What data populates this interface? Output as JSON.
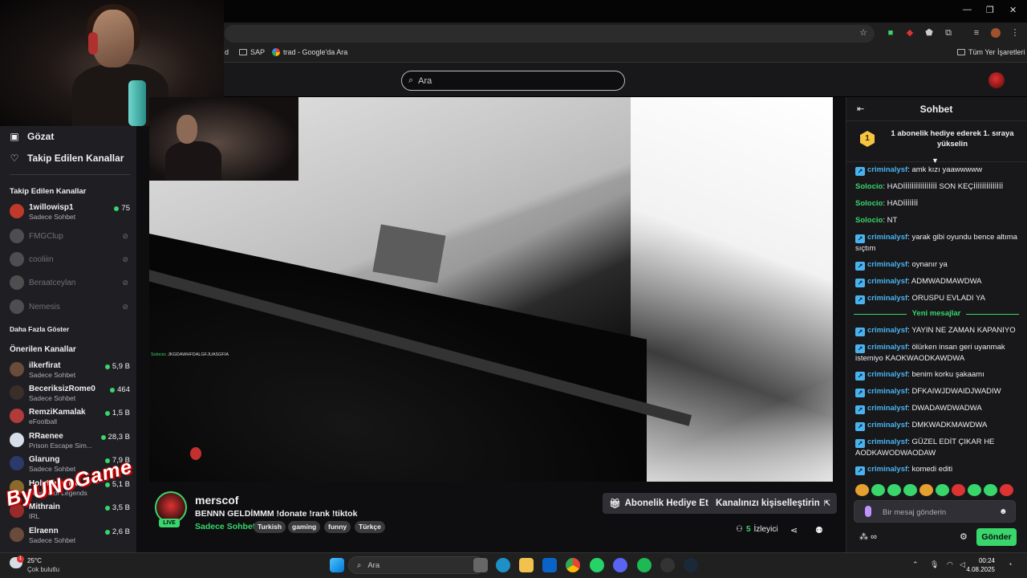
{
  "browser": {
    "bookmarks": [
      {
        "label": "d"
      },
      {
        "label": "SAP"
      },
      {
        "label": "trad - Google'da Ara"
      }
    ],
    "all_bookmarks": "Tüm Yer İşaretleri"
  },
  "header": {
    "search_placeholder": "Ara"
  },
  "sidebar": {
    "nav": [
      {
        "label": "Gözat",
        "icon": "browse-icon"
      },
      {
        "label": "Takip Edilen Kanallar",
        "icon": "heart-icon"
      }
    ],
    "followed_heading": "Takip Edilen Kanallar",
    "followed": [
      {
        "name": "1willowisp1",
        "category": "Sadece Sohbet",
        "viewers": "75",
        "live": true,
        "color": "#c0392b"
      },
      {
        "name": "FMGClup",
        "live": false
      },
      {
        "name": "cooliiin",
        "live": false
      },
      {
        "name": "Beraatceylan",
        "live": false
      },
      {
        "name": "Nemesis",
        "live": false
      }
    ],
    "show_more": "Daha Fazla Göster",
    "recommended_heading": "Önerilen Kanallar",
    "recommended": [
      {
        "name": "ilkerfirat",
        "category": "Sadece Sohbet",
        "viewers": "5,9 B",
        "color": "#6b4b3a"
      },
      {
        "name": "BeceriksizRome0",
        "category": "Sadece Sohbet",
        "viewers": "464",
        "color": "#3a2e28"
      },
      {
        "name": "RemziKamalak",
        "category": "eFootball",
        "viewers": "1,5 B",
        "color": "#b23a3a"
      },
      {
        "name": "RRaenee",
        "category": "Prison Escape Sim...",
        "viewers": "28,3 B",
        "color": "#d8dfe8"
      },
      {
        "name": "Glarung",
        "category": "Sadece Sohbet",
        "viewers": "7,9 B",
        "color": "#2b3a6a"
      },
      {
        "name": "HolyPhoenix",
        "category": "League of Legends",
        "viewers": "5,1 B",
        "color": "#8a6a2a"
      },
      {
        "name": "Mithrain",
        "category": "IRL",
        "viewers": "3,5 B",
        "color": "#9a2a2a"
      },
      {
        "name": "Elraenn",
        "category": "Sadece Sohbet",
        "viewers": "2,6 B",
        "color": "#6a4a3a"
      }
    ]
  },
  "player": {
    "overlay_user": "Solocio",
    "overlay_text": ": JKGDAWHFDALGFJUASGFIA"
  },
  "stream": {
    "streamer": "merscof",
    "live_label": "LIVE",
    "title": "BENNN GELDİMMM !donate !rank !tiktok",
    "category": "Sadece Sohbet",
    "tags": [
      "Turkish",
      "gaming",
      "funny",
      "Türkçe"
    ],
    "gift_button": "Abonelik Hediye Et",
    "customize_button": "Kanalınızı kişiselleştirin",
    "viewer_count": "5",
    "viewer_label": "İzleyici"
  },
  "watermark": "ByUNoGame",
  "chat": {
    "title": "Sohbet",
    "banner_rank": "1",
    "banner_text": "1 abonelik hediye ederek 1. sıraya yükselin",
    "messages_before": [
      {
        "user": "criminalysf",
        "text": "amk kızı yaawwwww",
        "badge": true
      },
      {
        "user": "Solocio",
        "text": "HADİİİİİİİİİİİİİİİİ SON KEÇİİİİİİİİİİİİİİ",
        "badge": false
      },
      {
        "user": "Solocio",
        "text": "HADİİİİİİİ",
        "badge": false
      },
      {
        "user": "Solocio",
        "text": "NT",
        "badge": false
      },
      {
        "user": "criminalysf",
        "text": "yarak gibi oyundu bence altıma sıçtım",
        "badge": true
      },
      {
        "user": "criminalysf",
        "text": "oynanır ya",
        "badge": true
      },
      {
        "user": "criminalysf",
        "text": "ADMWADMAWDWA",
        "badge": true
      },
      {
        "user": "criminalysf",
        "text": "ORUSPU EVLADI YA",
        "badge": true
      }
    ],
    "new_messages_label": "Yeni mesajlar",
    "messages_after": [
      {
        "user": "criminalysf",
        "text": "YAYIN NE ZAMAN KAPANIYO",
        "badge": true
      },
      {
        "user": "criminalysf",
        "text": "ölürken insan geri uyanmak istemiyo KAOKWAODKAWDWA",
        "badge": true
      },
      {
        "user": "criminalysf",
        "text": "benim korku şakaamı",
        "badge": true
      },
      {
        "user": "criminalysf",
        "text": "DFKAIWJDWAIDJWADIW",
        "badge": true
      },
      {
        "user": "criminalysf",
        "text": "DWADAWDWADWA",
        "badge": true
      },
      {
        "user": "criminalysf",
        "text": "DMKWADKMAWDWA",
        "badge": true
      },
      {
        "user": "criminalysf",
        "text": "GÜZEL EDİT ÇIKAR HE AODKAWODWAODAW",
        "badge": true
      },
      {
        "user": "criminalysf",
        "text": "komedi editi",
        "badge": true
      }
    ],
    "input_placeholder": "Bir mesaj gönderin",
    "send_label": "Gönder",
    "footer_label": "∞"
  },
  "taskbar": {
    "weather_badge": "1",
    "temperature": "25°C",
    "weather": "Çok bulutlu",
    "search_placeholder": "Ara",
    "time": "00:24",
    "date": "4.08.2025"
  }
}
